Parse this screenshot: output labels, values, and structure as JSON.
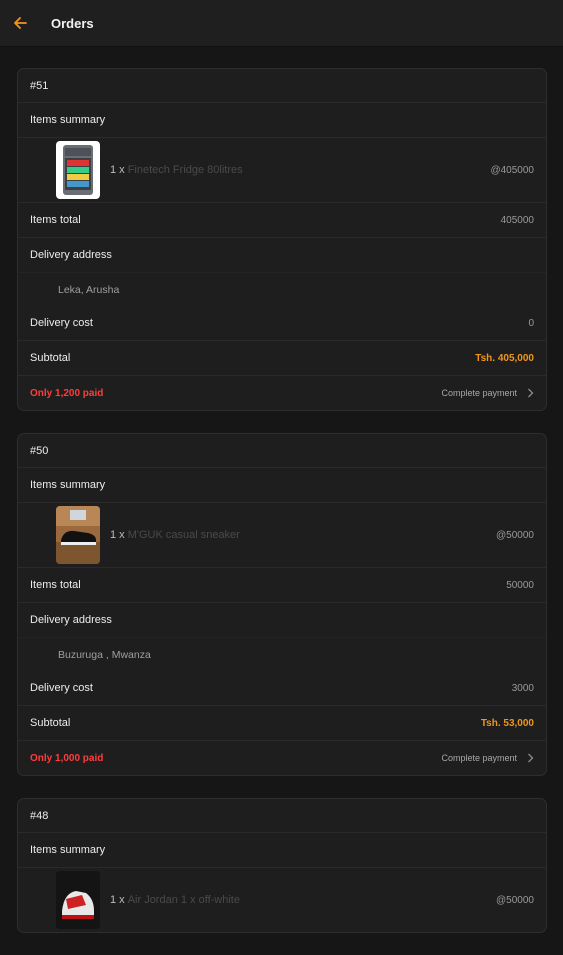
{
  "appbar": {
    "title": "Orders"
  },
  "labels": {
    "items_summary": "Items summary",
    "items_total": "Items total",
    "delivery_address": "Delivery address",
    "delivery_cost": "Delivery cost",
    "subtotal": "Subtotal",
    "complete_payment": "Complete payment",
    "qty_prefix": "1 x"
  },
  "orders": [
    {
      "id": "#51",
      "item": {
        "name": "Finetech Fridge 80litres",
        "price": "@405000",
        "thumb": "fridge-image"
      },
      "items_total": "405000",
      "address": "Leka, Arusha",
      "delivery_cost": "0",
      "subtotal": "Tsh. 405,000",
      "paid": "Only 1,200 paid"
    },
    {
      "id": "#50",
      "item": {
        "name": "M'GUK casual sneaker",
        "price": "@50000",
        "thumb": "sneaker-image"
      },
      "items_total": "50000",
      "address": "Buzuruga , Mwanza",
      "delivery_cost": "3000",
      "subtotal": "Tsh. 53,000",
      "paid": "Only 1,000 paid"
    },
    {
      "id": "#48",
      "item": {
        "name": "Air Jordan 1 x off-white",
        "price": "@50000",
        "thumb": "jordan-image"
      }
    }
  ],
  "colors": {
    "accent": "#f0961e",
    "alert": "#ff3d3d",
    "background": "#161616",
    "card": "#1e1e1e"
  }
}
